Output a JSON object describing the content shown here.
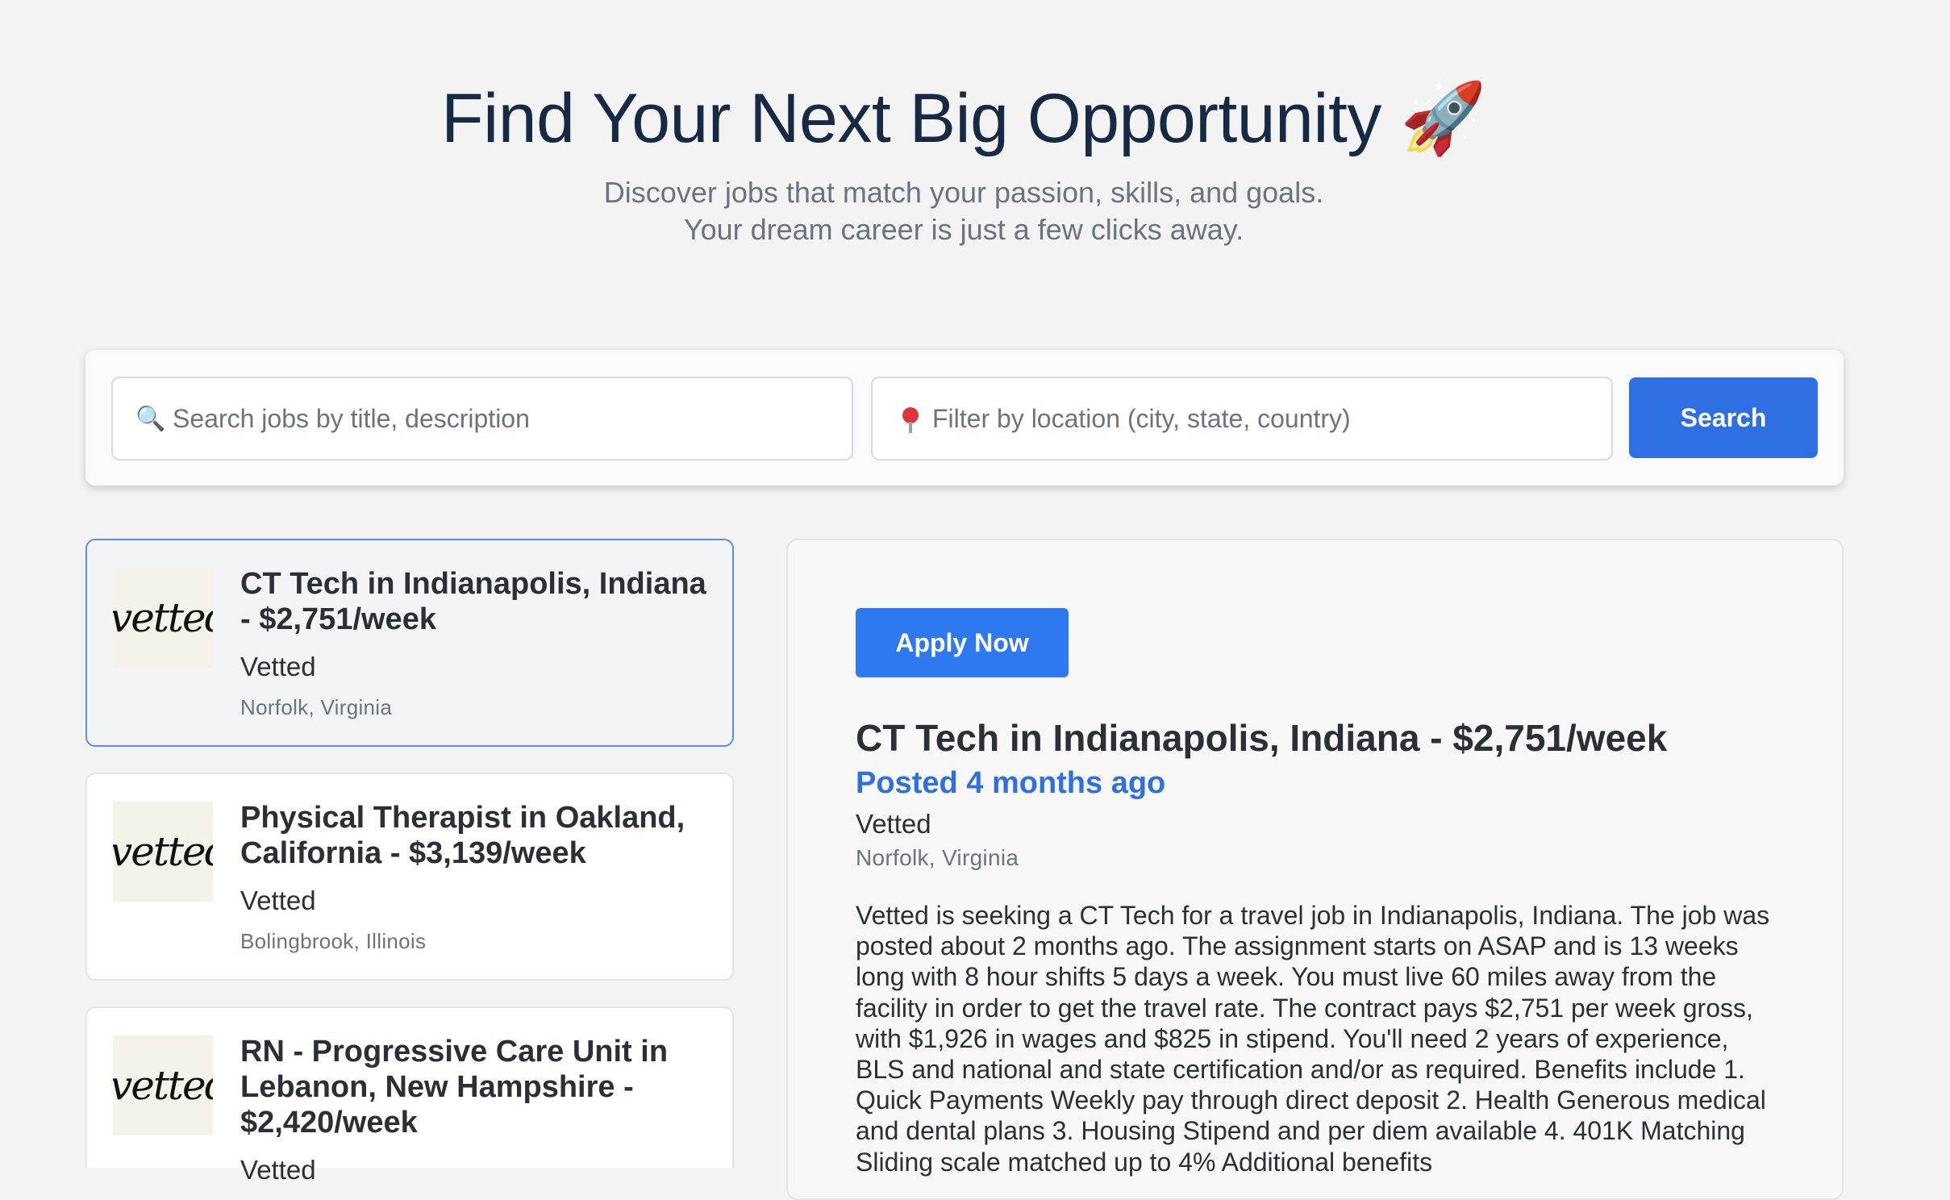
{
  "hero": {
    "title": "Find Your Next Big Opportunity",
    "title_icon": "🚀",
    "subtitle_line1": "Discover jobs that match your passion, skills, and goals.",
    "subtitle_line2": "Your dream career is just a few clicks away."
  },
  "search": {
    "keyword_placeholder": "Search jobs by title, description",
    "keyword_icon": "🔍",
    "location_placeholder": "Filter by location (city, state, country)",
    "location_icon": "pin-icon",
    "button_label": "Search"
  },
  "jobs": [
    {
      "title": "CT Tech in Indianapolis, Indiana - $2,751/week",
      "company": "Vetted",
      "location": "Norfolk, Virginia",
      "logo_text": "vetted",
      "selected": true
    },
    {
      "title": "Physical Therapist in Oakland, California - $3,139/week",
      "company": "Vetted",
      "location": "Bolingbrook, Illinois",
      "logo_text": "vetted",
      "selected": false
    },
    {
      "title": "RN - Progressive Care Unit in Lebanon, New Hampshire - $2,420/week",
      "company": "Vetted",
      "location": "",
      "logo_text": "vetted",
      "selected": false
    }
  ],
  "detail": {
    "apply_label": "Apply Now",
    "title": "CT Tech in Indianapolis, Indiana - $2,751/week",
    "posted": "Posted 4 months ago",
    "company": "Vetted",
    "location": "Norfolk, Virginia",
    "description": "Vetted is seeking a CT Tech for a travel job in Indianapolis, Indiana. The job was posted about 2 months ago. The assignment starts on ASAP and is 13 weeks long with 8 hour shifts 5 days a week. You must live 60 miles away from the facility in order to get the travel rate. The contract pays $2,751 per week gross, with $1,926 in wages and $825 in stipend. You'll need 2 years of experience, BLS and national and state certification and/or as required. Benefits include 1. Quick Payments Weekly pay through direct deposit 2. Health Generous medical and dental plans 3. Housing Stipend and per diem available 4. 401K Matching Sliding scale matched up to 4% Additional benefits"
  },
  "colors": {
    "accent": "#2f6fe4",
    "background": "#f3f3f4",
    "heading": "#172a45"
  }
}
